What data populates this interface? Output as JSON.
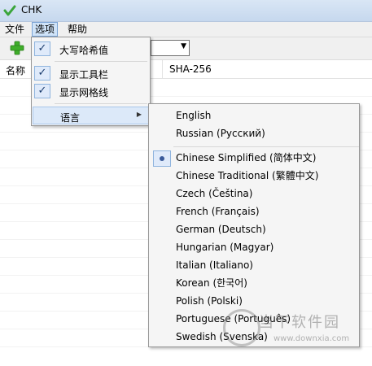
{
  "window": {
    "title": "CHK"
  },
  "menubar": {
    "file": "文件",
    "options": "选项",
    "help": "帮助"
  },
  "list": {
    "col_name": "名称",
    "col_hash": "SHA-256"
  },
  "options_menu": {
    "items": [
      {
        "label": "大写哈希值",
        "checked": true
      },
      {
        "label": "显示工具栏",
        "checked": true
      },
      {
        "label": "显示网格线",
        "checked": true
      },
      {
        "label": "语言",
        "submenu": true
      }
    ]
  },
  "language_menu": {
    "items": [
      {
        "label": "English"
      },
      {
        "label": "Russian (Русский)"
      },
      {
        "label": "Chinese Simplified (简体中文)",
        "selected": true
      },
      {
        "label": "Chinese Traditional (繁體中文)"
      },
      {
        "label": "Czech (Čeština)"
      },
      {
        "label": "French (Français)"
      },
      {
        "label": "German (Deutsch)"
      },
      {
        "label": "Hungarian (Magyar)"
      },
      {
        "label": "Italian (Italiano)"
      },
      {
        "label": "Korean (한국어)"
      },
      {
        "label": "Polish (Polski)"
      },
      {
        "label": "Portuguese (Português)"
      },
      {
        "label": "Swedish (Svenska)"
      }
    ]
  },
  "watermark": {
    "name": "当下软件园",
    "url": "www.downxia.com"
  }
}
